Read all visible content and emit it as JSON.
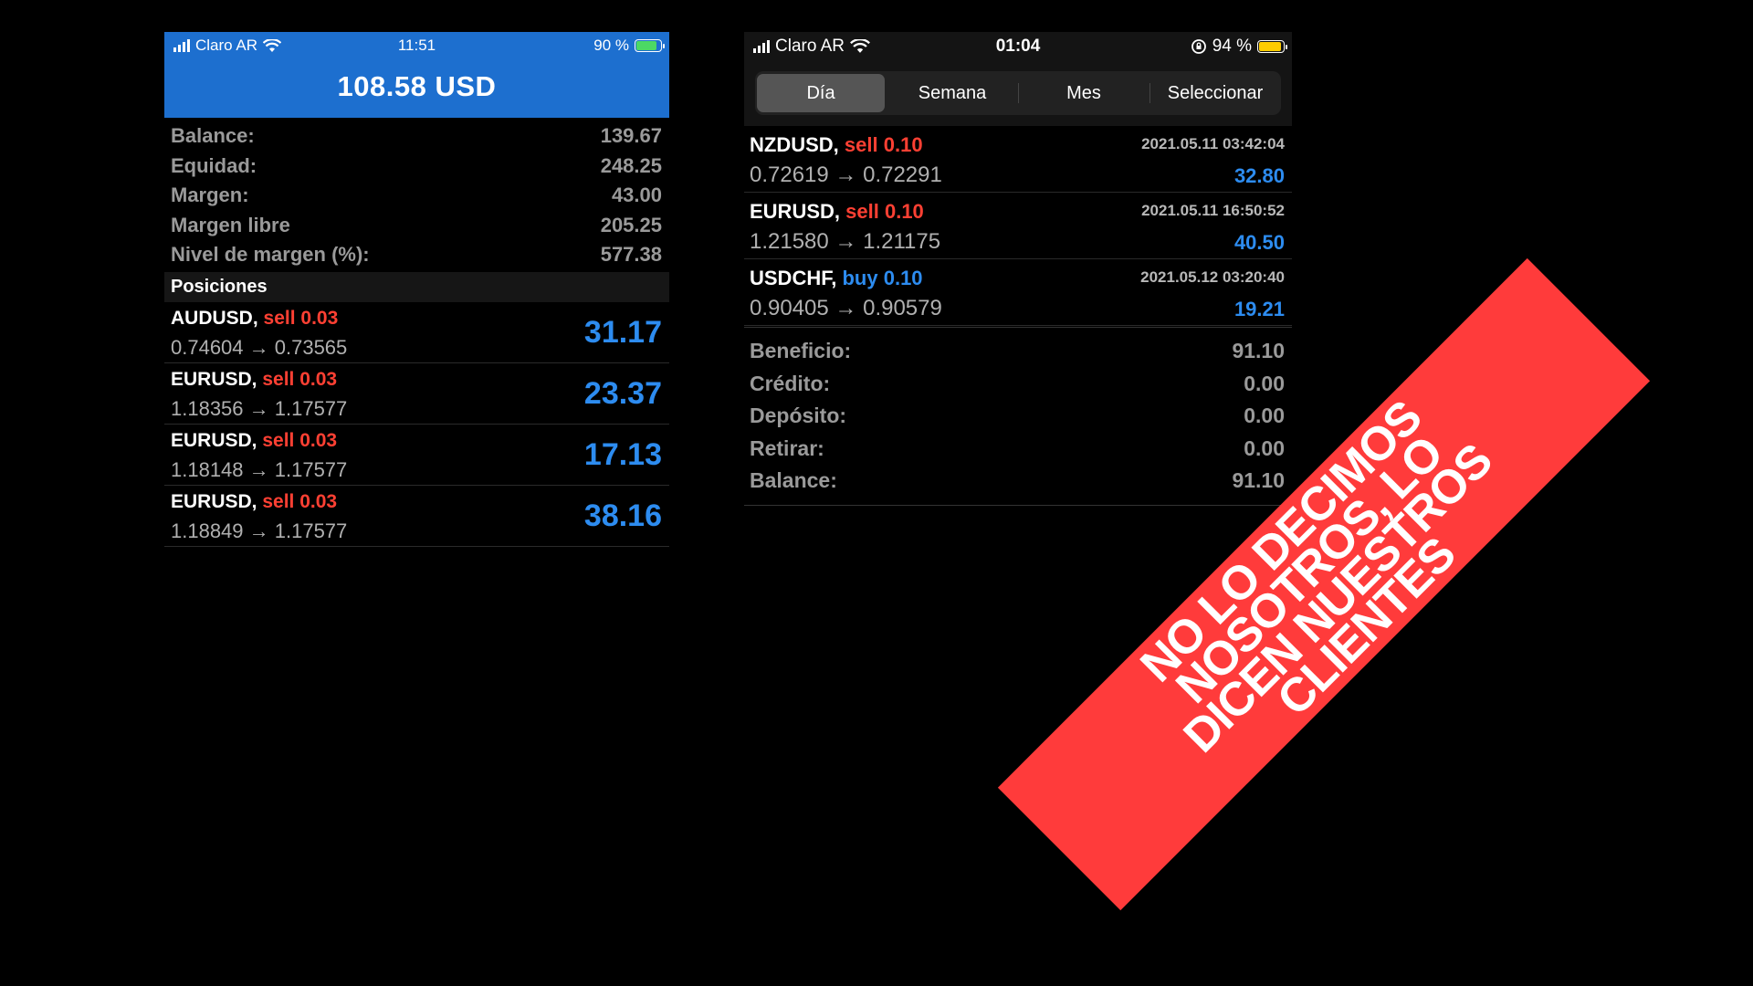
{
  "left": {
    "status": {
      "carrier": "Claro AR",
      "time": "11:51",
      "battery": "90 %"
    },
    "equity": "108.58 USD",
    "summary": [
      {
        "label": "Balance:",
        "value": "139.67"
      },
      {
        "label": "Equidad:",
        "value": "248.25"
      },
      {
        "label": "Margen:",
        "value": "43.00"
      },
      {
        "label": "Margen libre",
        "value": "205.25"
      },
      {
        "label": "Nivel de margen (%):",
        "value": "577.38"
      }
    ],
    "section_title": "Posiciones",
    "positions": [
      {
        "symbol": "AUDUSD,",
        "side": "sell",
        "lot": "0.03",
        "prices": "0.74604 → 0.73565",
        "profit": "31.17"
      },
      {
        "symbol": "EURUSD,",
        "side": "sell",
        "lot": "0.03",
        "prices": "1.18356 → 1.17577",
        "profit": "23.37"
      },
      {
        "symbol": "EURUSD,",
        "side": "sell",
        "lot": "0.03",
        "prices": "1.18148 → 1.17577",
        "profit": "17.13"
      },
      {
        "symbol": "EURUSD,",
        "side": "sell",
        "lot": "0.03",
        "prices": "1.18849 → 1.17577",
        "profit": "38.16"
      }
    ]
  },
  "right": {
    "status": {
      "carrier": "Claro AR",
      "time": "01:04",
      "battery": "94 %"
    },
    "tabs": [
      "Día",
      "Semana",
      "Mes",
      "Seleccionar"
    ],
    "deals": [
      {
        "symbol": "NZDUSD,",
        "side": "sell",
        "lot": "0.10",
        "date": "2021.05.11 03:42:04",
        "prices": "0.72619 → 0.72291",
        "profit": "32.80"
      },
      {
        "symbol": "EURUSD,",
        "side": "sell",
        "lot": "0.10",
        "date": "2021.05.11 16:50:52",
        "prices": "1.21580 → 1.21175",
        "profit": "40.50"
      },
      {
        "symbol": "USDCHF,",
        "side": "buy",
        "lot": "0.10",
        "date": "2021.05.12 03:20:40",
        "prices": "0.90405 → 0.90579",
        "profit": "19.21"
      }
    ],
    "totals": [
      {
        "label": "Beneficio:",
        "value": "91.10"
      },
      {
        "label": "Crédito:",
        "value": "0.00"
      },
      {
        "label": "Depósito:",
        "value": "0.00"
      },
      {
        "label": "Retirar:",
        "value": "0.00"
      },
      {
        "label": "Balance:",
        "value": "91.10"
      }
    ]
  },
  "banner": {
    "lines": [
      "NO LO DECIMOS",
      "NOSOTROS, LO",
      "DICEN NUESTROS",
      "CLIENTES"
    ]
  },
  "colors": {
    "header_blue": "#1d6fcf",
    "profit_blue": "#2d8cf0",
    "sell_red": "#ff4033",
    "banner_red": "#ff3b3b",
    "battery_green": "#4cd964",
    "battery_yellow": "#ffcc00"
  }
}
